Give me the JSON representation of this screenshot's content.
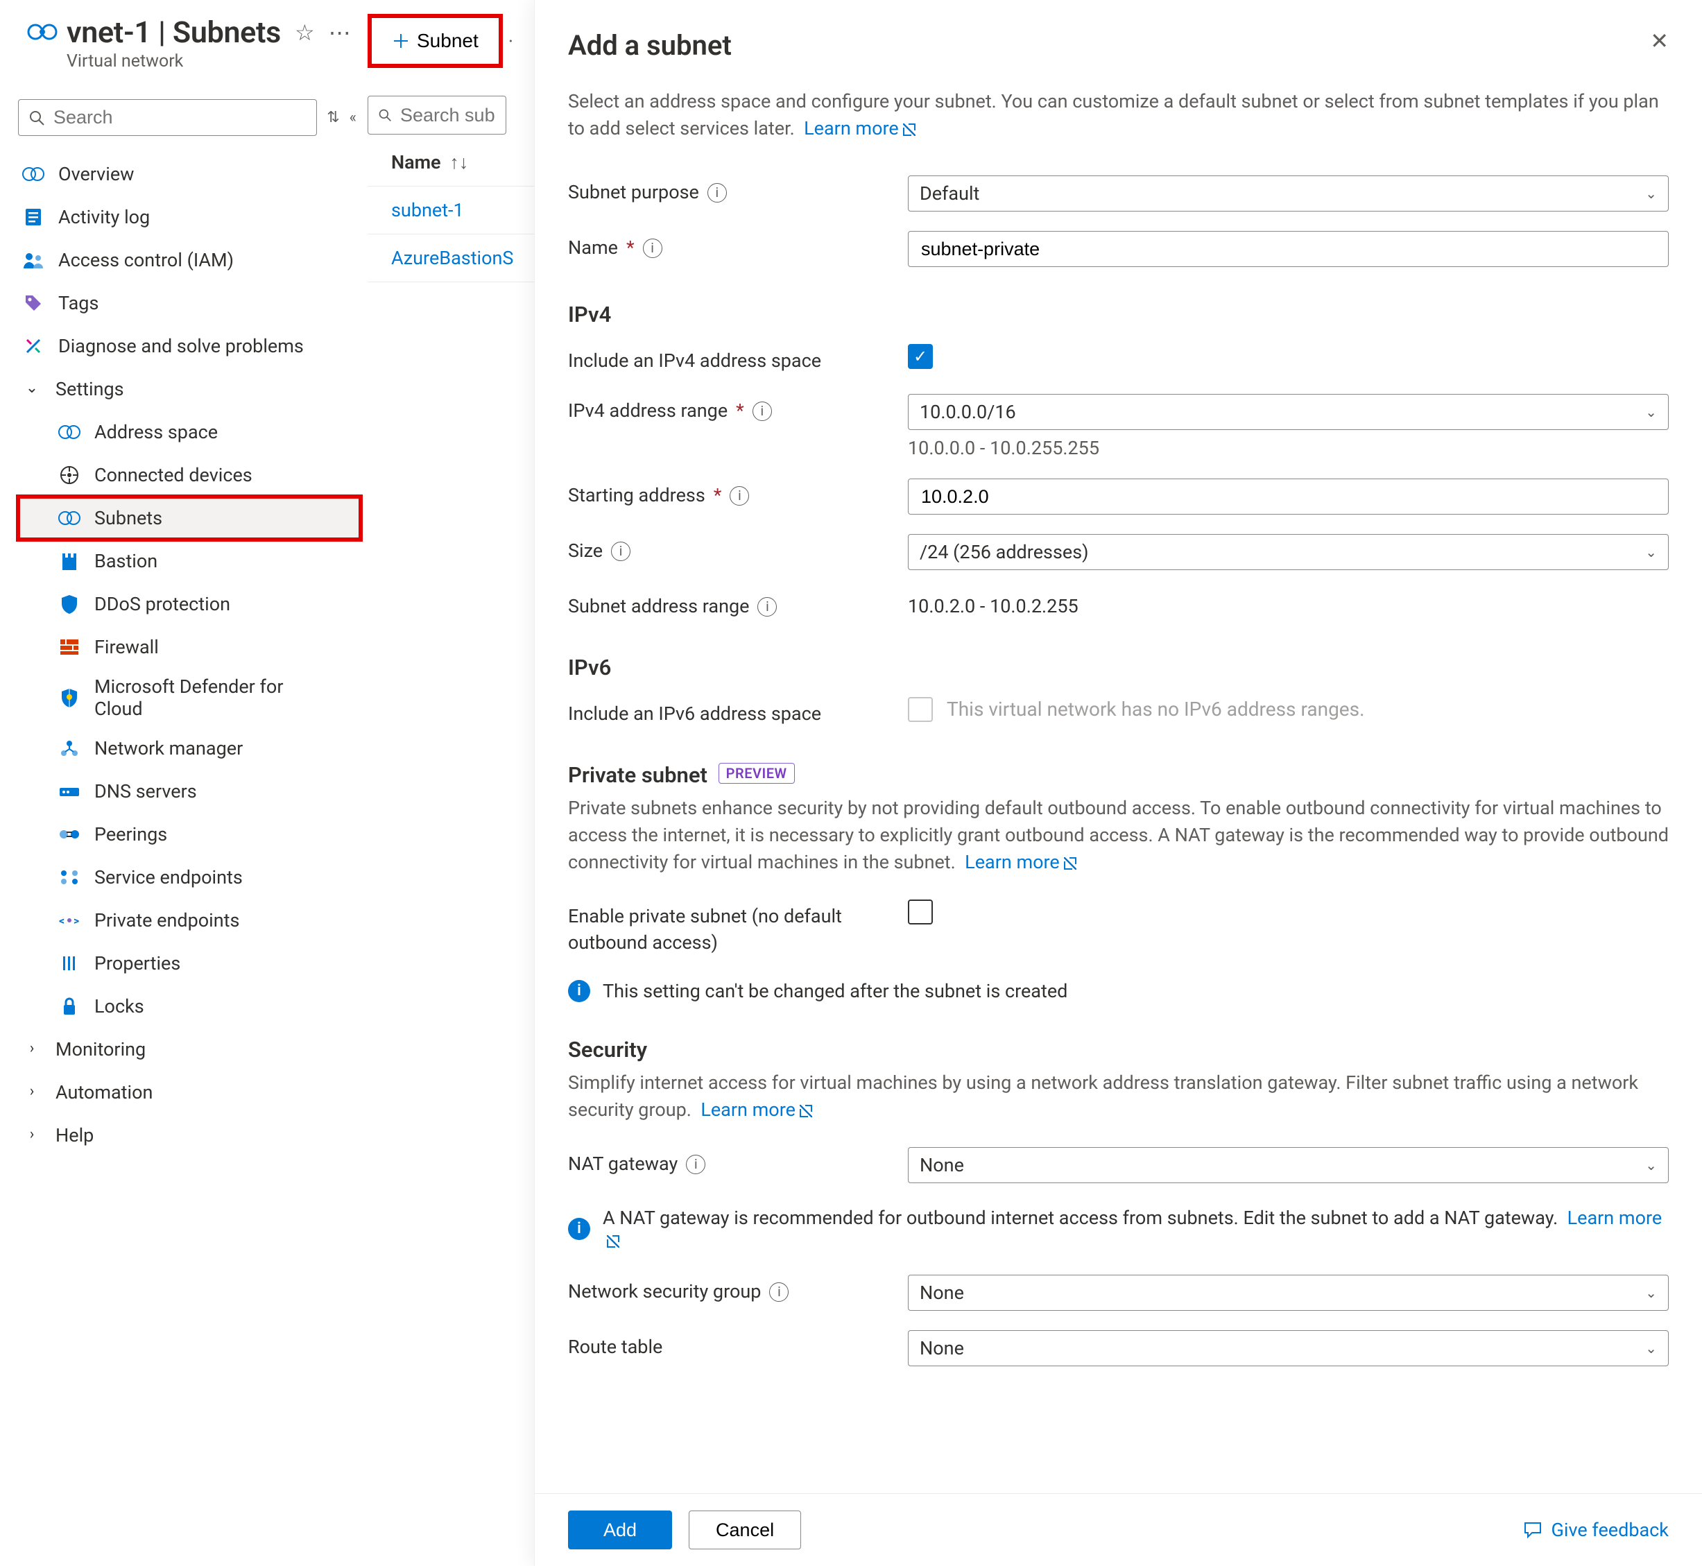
{
  "header": {
    "title": "vnet-1 | Subnets",
    "subtitle": "Virtual network"
  },
  "sidebar": {
    "search_placeholder": "Search",
    "items": [
      {
        "label": "Overview",
        "icon": "vnet"
      },
      {
        "label": "Activity log",
        "icon": "log"
      },
      {
        "label": "Access control (IAM)",
        "icon": "iam"
      },
      {
        "label": "Tags",
        "icon": "tags"
      },
      {
        "label": "Diagnose and solve problems",
        "icon": "diag"
      }
    ],
    "settings_label": "Settings",
    "settings": [
      {
        "label": "Address space",
        "icon": "vnet"
      },
      {
        "label": "Connected devices",
        "icon": "devices"
      },
      {
        "label": "Subnets",
        "icon": "vnet",
        "active": true
      },
      {
        "label": "Bastion",
        "icon": "bastion"
      },
      {
        "label": "DDoS protection",
        "icon": "shield"
      },
      {
        "label": "Firewall",
        "icon": "firewall"
      },
      {
        "label": "Microsoft Defender for Cloud",
        "icon": "defender"
      },
      {
        "label": "Network manager",
        "icon": "netmgr"
      },
      {
        "label": "DNS servers",
        "icon": "dns"
      },
      {
        "label": "Peerings",
        "icon": "peerings"
      },
      {
        "label": "Service endpoints",
        "icon": "svc-ep"
      },
      {
        "label": "Private endpoints",
        "icon": "priv-ep"
      },
      {
        "label": "Properties",
        "icon": "props"
      },
      {
        "label": "Locks",
        "icon": "locks"
      }
    ],
    "groups": [
      {
        "label": "Monitoring"
      },
      {
        "label": "Automation"
      },
      {
        "label": "Help"
      }
    ]
  },
  "toolbar": {
    "add_subnet_label": "Subnet"
  },
  "content": {
    "search_placeholder": "Search subnets",
    "column_name": "Name",
    "rows": [
      {
        "name": "subnet-1"
      },
      {
        "name": "AzureBastionSubnet",
        "display": "AzureBastionS"
      }
    ]
  },
  "panel": {
    "title": "Add a subnet",
    "intro": "Select an address space and configure your subnet. You can customize a default subnet or select from subnet templates if you plan to add select services later.",
    "learn_more": "Learn more",
    "subnet_purpose_label": "Subnet purpose",
    "subnet_purpose_value": "Default",
    "name_label": "Name",
    "name_value": "subnet-private",
    "ipv4_heading": "IPv4",
    "include_ipv4_label": "Include an IPv4 address space",
    "include_ipv4_checked": true,
    "ipv4_range_label": "IPv4 address range",
    "ipv4_range_value": "10.0.0.0/16",
    "ipv4_range_desc": "10.0.0.0 - 10.0.255.255",
    "start_addr_label": "Starting address",
    "start_addr_value": "10.0.2.0",
    "size_label": "Size",
    "size_value": "/24 (256 addresses)",
    "subnet_range_label": "Subnet address range",
    "subnet_range_value": "10.0.2.0 - 10.0.2.255",
    "ipv6_heading": "IPv6",
    "include_ipv6_label": "Include an IPv6 address space",
    "ipv6_disabled_note": "This virtual network has no IPv6 address ranges.",
    "private_heading": "Private subnet",
    "preview_badge": "PREVIEW",
    "private_desc": "Private subnets enhance security by not providing default outbound access. To enable outbound connectivity for virtual machines to access the internet, it is necessary to explicitly grant outbound access. A NAT gateway is the recommended way to provide outbound connectivity for virtual machines in the subnet.",
    "enable_private_label": "Enable private subnet (no default outbound access)",
    "enable_private_checked": false,
    "private_note": "This setting can't be changed after the subnet is created",
    "security_heading": "Security",
    "security_desc": "Simplify internet access for virtual machines by using a network address translation gateway. Filter subnet traffic using a network security group.",
    "nat_label": "NAT gateway",
    "nat_value": "None",
    "nat_note": "A NAT gateway is recommended for outbound internet access from subnets. Edit the subnet to add a NAT gateway.",
    "nsg_label": "Network security group",
    "nsg_value": "None",
    "route_label": "Route table",
    "route_value": "None",
    "add_button": "Add",
    "cancel_button": "Cancel",
    "feedback": "Give feedback"
  }
}
